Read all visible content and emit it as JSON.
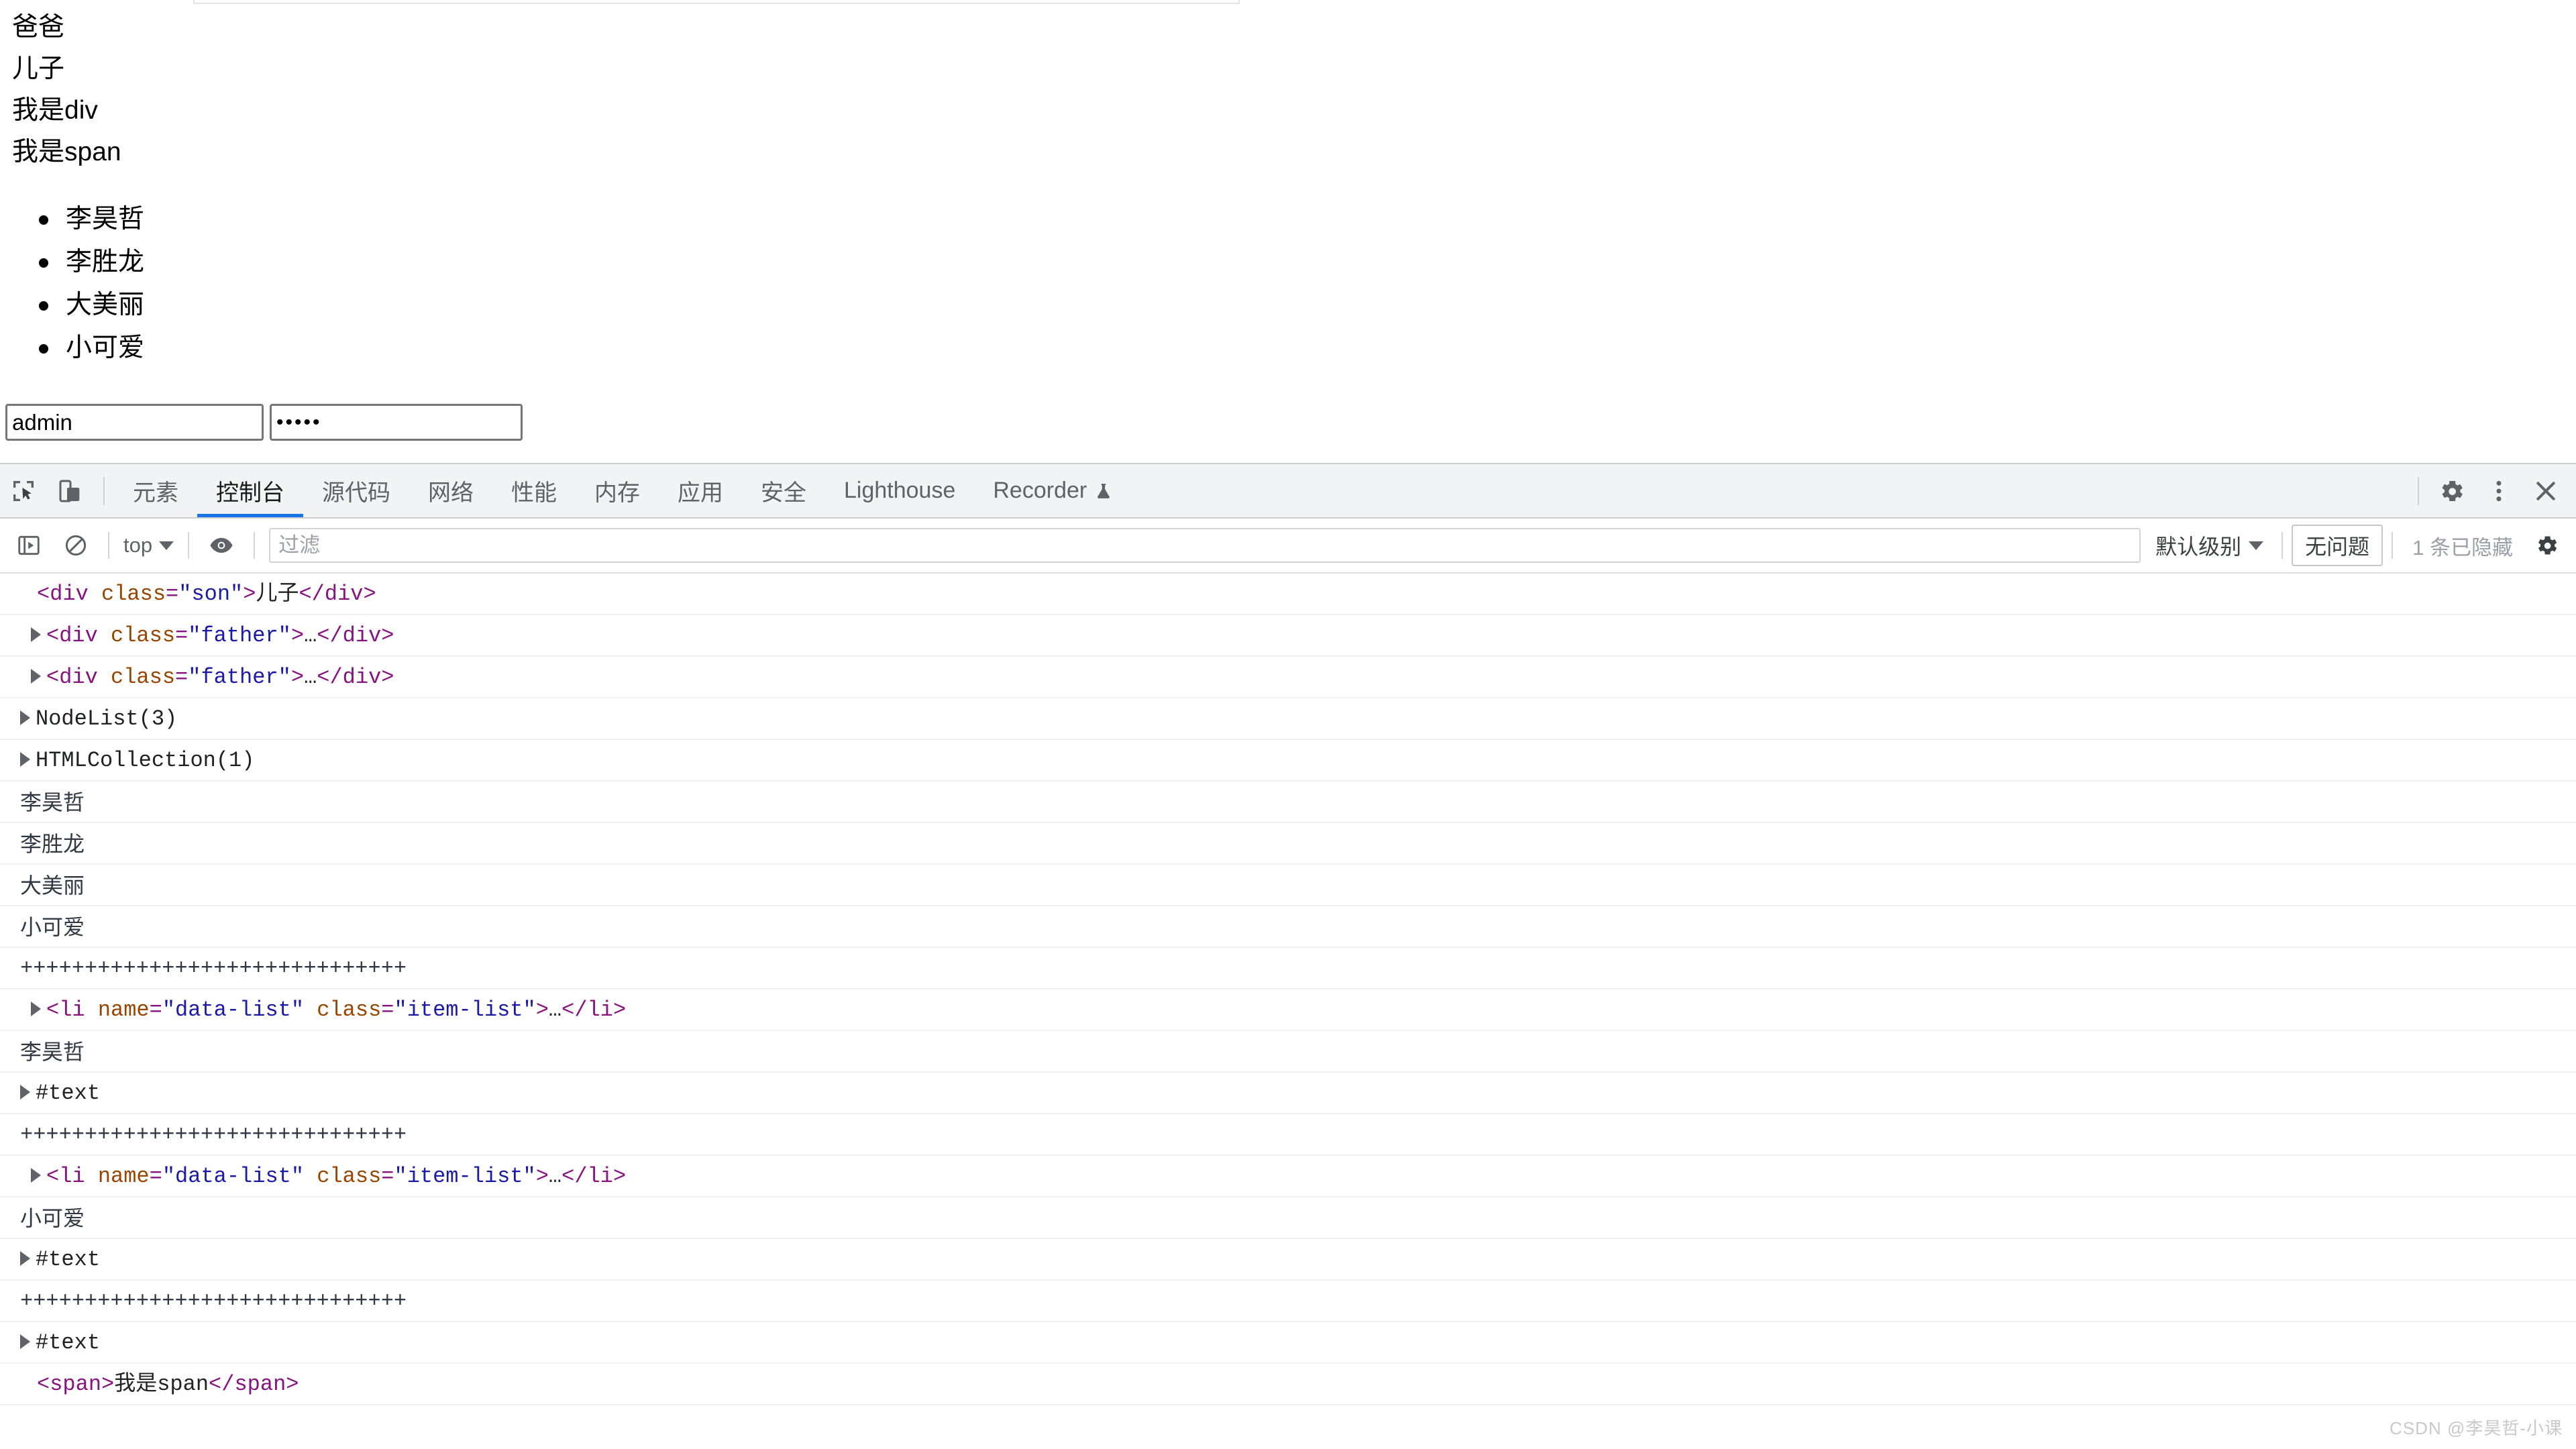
{
  "page": {
    "lines": [
      "爸爸",
      "儿子",
      "我是div",
      "我是span"
    ],
    "list_items": [
      "李昊哲",
      "李胜龙",
      "大美丽",
      "小可爱"
    ],
    "username_value": "admin",
    "username_placeholder": "",
    "password_value": "•••••",
    "password_placeholder": ""
  },
  "devtools": {
    "inspect_icon": "inspect-element-icon",
    "device_icon": "device-toolbar-icon",
    "tabs": [
      {
        "label": "元素",
        "active": false
      },
      {
        "label": "控制台",
        "active": true
      },
      {
        "label": "源代码",
        "active": false
      },
      {
        "label": "网络",
        "active": false
      },
      {
        "label": "性能",
        "active": false
      },
      {
        "label": "内存",
        "active": false
      },
      {
        "label": "应用",
        "active": false
      },
      {
        "label": "安全",
        "active": false
      },
      {
        "label": "Lighthouse",
        "active": false
      },
      {
        "label": "Recorder",
        "active": false,
        "icon": "flask-icon"
      }
    ],
    "settings_icon": "gear-icon",
    "more_icon": "kebab-menu-icon",
    "close_icon": "close-icon"
  },
  "console_toolbar": {
    "sidebar_toggle_icon": "console-sidebar-icon",
    "clear_icon": "clear-console-icon",
    "context_label": "top",
    "eye_icon": "live-expression-icon",
    "filter_placeholder": "过滤",
    "filter_value": "",
    "level_label": "默认级别",
    "issues_label": "无问题",
    "hidden_count_label": "1 条已隐藏",
    "settings_icon": "gear-icon"
  },
  "console_rows": [
    {
      "kind": "html",
      "arrow": false,
      "parts": [
        {
          "t": "tag",
          "s": "<div "
        },
        {
          "t": "attr",
          "s": "class"
        },
        {
          "t": "tag",
          "s": "="
        },
        {
          "t": "val",
          "s": "\"son\""
        },
        {
          "t": "tag",
          "s": ">"
        },
        {
          "t": "txt",
          "s": "儿子"
        },
        {
          "t": "tag",
          "s": "</div>"
        }
      ]
    },
    {
      "kind": "html",
      "arrow": true,
      "parts": [
        {
          "t": "tag",
          "s": "<div "
        },
        {
          "t": "attr",
          "s": "class"
        },
        {
          "t": "tag",
          "s": "="
        },
        {
          "t": "val",
          "s": "\"father\""
        },
        {
          "t": "tag",
          "s": ">"
        },
        {
          "t": "txt",
          "s": "…"
        },
        {
          "t": "tag",
          "s": "</div>"
        }
      ]
    },
    {
      "kind": "html",
      "arrow": true,
      "parts": [
        {
          "t": "tag",
          "s": "<div "
        },
        {
          "t": "attr",
          "s": "class"
        },
        {
          "t": "tag",
          "s": "="
        },
        {
          "t": "val",
          "s": "\"father\""
        },
        {
          "t": "tag",
          "s": ">"
        },
        {
          "t": "txt",
          "s": "…"
        },
        {
          "t": "tag",
          "s": "</div>"
        }
      ]
    },
    {
      "kind": "object",
      "arrow": true,
      "text": "NodeList(3)"
    },
    {
      "kind": "object",
      "arrow": true,
      "text": "HTMLCollection(1)"
    },
    {
      "kind": "text",
      "arrow": false,
      "text": "李昊哲"
    },
    {
      "kind": "text",
      "arrow": false,
      "text": "李胜龙"
    },
    {
      "kind": "text",
      "arrow": false,
      "text": "大美丽"
    },
    {
      "kind": "text",
      "arrow": false,
      "text": "小可爱"
    },
    {
      "kind": "plus",
      "arrow": false,
      "text": "++++++++++++++++++++++++++++++"
    },
    {
      "kind": "html",
      "arrow": true,
      "parts": [
        {
          "t": "tag",
          "s": "<li "
        },
        {
          "t": "attr",
          "s": "name"
        },
        {
          "t": "tag",
          "s": "="
        },
        {
          "t": "val",
          "s": "\"data-list\""
        },
        {
          "t": "tag",
          "s": " "
        },
        {
          "t": "attr",
          "s": "class"
        },
        {
          "t": "tag",
          "s": "="
        },
        {
          "t": "val",
          "s": "\"item-list\""
        },
        {
          "t": "tag",
          "s": ">"
        },
        {
          "t": "txt",
          "s": "…"
        },
        {
          "t": "tag",
          "s": "</li>"
        }
      ]
    },
    {
      "kind": "text",
      "arrow": false,
      "text": "李昊哲"
    },
    {
      "kind": "object",
      "arrow": true,
      "text": "#text"
    },
    {
      "kind": "plus",
      "arrow": false,
      "text": "++++++++++++++++++++++++++++++"
    },
    {
      "kind": "html",
      "arrow": true,
      "parts": [
        {
          "t": "tag",
          "s": "<li "
        },
        {
          "t": "attr",
          "s": "name"
        },
        {
          "t": "tag",
          "s": "="
        },
        {
          "t": "val",
          "s": "\"data-list\""
        },
        {
          "t": "tag",
          "s": " "
        },
        {
          "t": "attr",
          "s": "class"
        },
        {
          "t": "tag",
          "s": "="
        },
        {
          "t": "val",
          "s": "\"item-list\""
        },
        {
          "t": "tag",
          "s": ">"
        },
        {
          "t": "txt",
          "s": "…"
        },
        {
          "t": "tag",
          "s": "</li>"
        }
      ]
    },
    {
      "kind": "text",
      "arrow": false,
      "text": "小可爱"
    },
    {
      "kind": "object",
      "arrow": true,
      "text": "#text"
    },
    {
      "kind": "plus",
      "arrow": false,
      "text": "++++++++++++++++++++++++++++++"
    },
    {
      "kind": "object",
      "arrow": true,
      "text": "#text"
    },
    {
      "kind": "html",
      "arrow": false,
      "parts": [
        {
          "t": "tag",
          "s": "<span>"
        },
        {
          "t": "txt",
          "s": "我是span"
        },
        {
          "t": "tag",
          "s": "</span>"
        }
      ]
    }
  ],
  "watermark": "CSDN @李昊哲-小课"
}
